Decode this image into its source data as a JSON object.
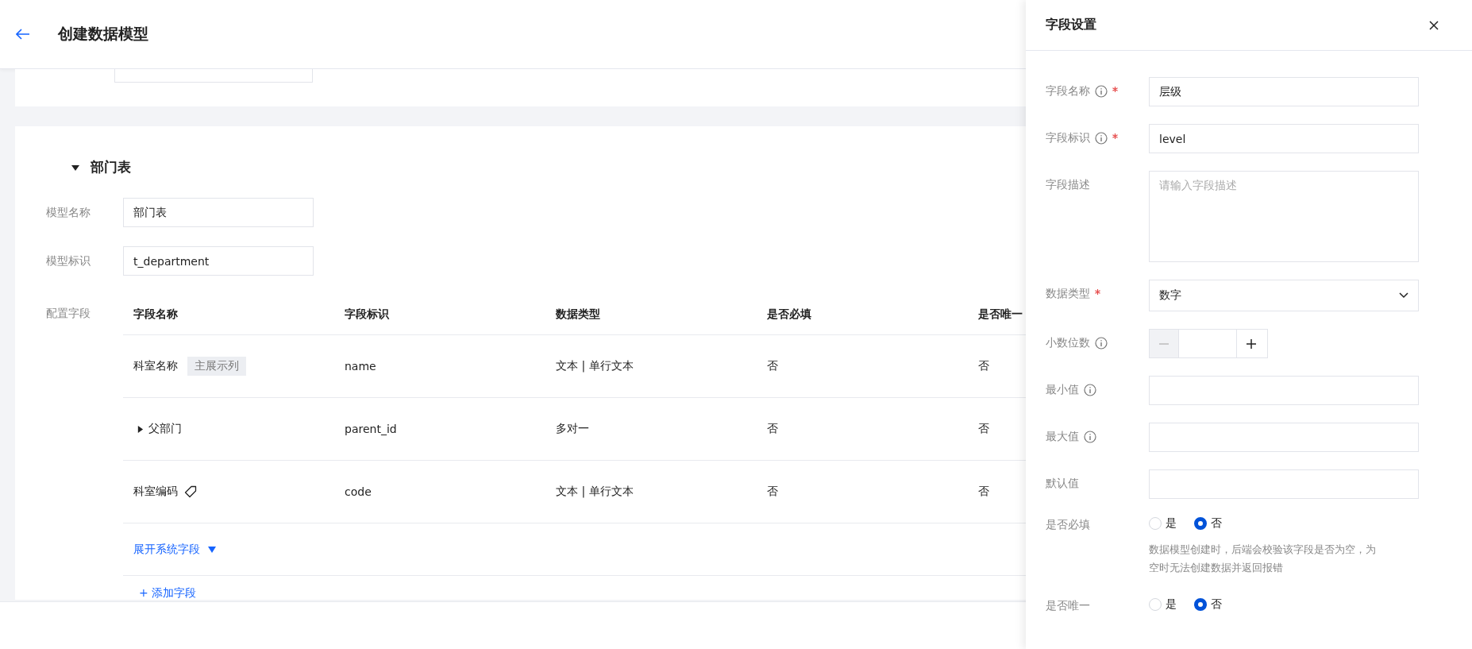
{
  "header": {
    "title": "创建数据模型"
  },
  "section": {
    "title": "部门表",
    "expanded": true,
    "fields": [
      {
        "label": "模型名称",
        "value": "部门表"
      },
      {
        "label": "模型标识",
        "value": "t_department"
      }
    ],
    "config_label": "配置字段",
    "table": {
      "columns": [
        "字段名称",
        "字段标识",
        "数据类型",
        "是否必填",
        "是否唯一"
      ],
      "rows": [
        {
          "kind": "badge",
          "name": {
            "text": "科室名称",
            "badge": "主展示列"
          },
          "identifier": "name",
          "data_type": "文本 | 单行文本",
          "required": "否",
          "unique": "否"
        },
        {
          "kind": "expandable",
          "name": {
            "text": "父部门",
            "expanded": false
          },
          "identifier": "parent_id",
          "data_type": "多对一",
          "required": "否",
          "unique": "否"
        },
        {
          "kind": "tag",
          "name": {
            "text": "科室编码"
          },
          "identifier": "code",
          "data_type": "文本 | 单行文本",
          "required": "否",
          "unique": "否"
        }
      ]
    },
    "expand_link": "展开系统字段",
    "add_link": "+ 添加字段"
  },
  "panel": {
    "title": "字段设置",
    "fields": [
      {
        "kind": "input",
        "label": "字段名称",
        "info": true,
        "required": true,
        "value": "层级"
      },
      {
        "kind": "input",
        "label": "字段标识",
        "info": true,
        "required": true,
        "value": "level"
      },
      {
        "kind": "textarea",
        "label": "字段描述",
        "info": false,
        "required": false,
        "placeholder": "请输入字段描述"
      },
      {
        "kind": "select",
        "label": "数据类型",
        "info": false,
        "required": true,
        "value": "数字"
      },
      {
        "kind": "stepper",
        "label": "小数位数",
        "info": true,
        "required": false,
        "decrement_disabled": true
      },
      {
        "kind": "input",
        "label": "最小值",
        "info": true,
        "required": false
      },
      {
        "kind": "input",
        "label": "最大值",
        "info": true,
        "required": false
      },
      {
        "kind": "input",
        "label": "默认值",
        "info": false,
        "required": false
      },
      {
        "kind": "radio",
        "label": "是否必填",
        "info": false,
        "required": false,
        "options": [
          {
            "label": "是",
            "selected": false
          },
          {
            "label": "否",
            "selected": true
          }
        ],
        "help": "数据模型创建时，后端会校验该字段是否为空，为空时无法创建数据并返回报错"
      },
      {
        "kind": "radio",
        "label": "是否唯一",
        "info": false,
        "required": false,
        "options": [
          {
            "label": "是",
            "selected": false
          },
          {
            "label": "否",
            "selected": true
          }
        ]
      }
    ]
  }
}
